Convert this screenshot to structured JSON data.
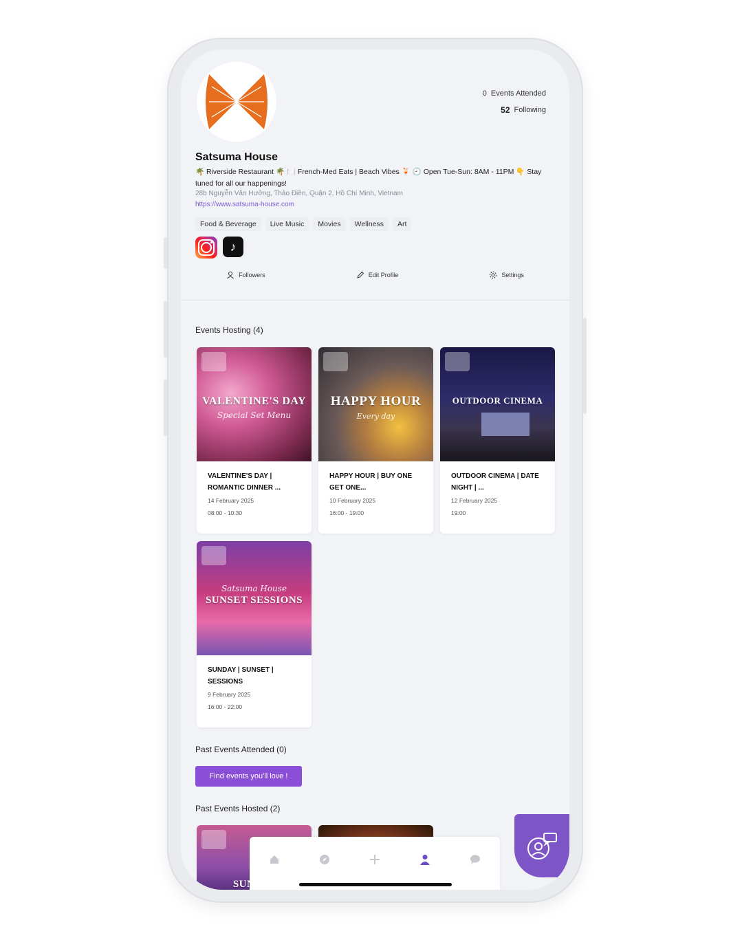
{
  "profile": {
    "name": "Satsuma House",
    "bio": "🌴 Riverside Restaurant 🌴 🍽️ French-Med Eats | Beach Vibes 🍹 🕘 Open Tue-Sun: 8AM - 11PM 👇 Stay tuned for all our happenings!",
    "address": "28b Nguyễn Văn Hưởng, Thảo Điền, Quận 2, Hồ Chí Minh, Vietnam",
    "website": "https://www.satsuma-house.com",
    "logo_color": "#E56F1E"
  },
  "stats": {
    "events_attended_count": "0",
    "events_attended_label": "Events Attended",
    "following_count": "52",
    "following_label": "Following"
  },
  "tags": [
    "Food & Beverage",
    "Live Music",
    "Movies",
    "Wellness",
    "Art"
  ],
  "social": [
    {
      "icon": "instagram-icon"
    },
    {
      "icon": "tiktok-icon"
    }
  ],
  "actions": {
    "followers": "Followers",
    "edit_profile": "Edit Profile",
    "settings": "Settings"
  },
  "sections": {
    "hosting": "Events Hosting (4)",
    "attended": "Past Events Attended (0)",
    "hosted": "Past Events Hosted (2)"
  },
  "events": [
    {
      "img_title": "VALENTINE'S DAY",
      "img_sub": "Special Set Menu",
      "title": "VALENTINE'S DAY | ROMANTIC DINNER ...",
      "date": "14 February 2025",
      "time": "08:00 - 10:30"
    },
    {
      "img_title": "HAPPY HOUR",
      "img_sub": "Every day",
      "title": "HAPPY HOUR | BUY ONE GET ONE...",
      "date": "10 February 2025",
      "time": "16:00 - 19:00"
    },
    {
      "img_title": "OUTDOOR CINEMA",
      "img_sub": "",
      "title": "OUTDOOR CINEMA | DATE NIGHT | ...",
      "date": "12 February 2025",
      "time": "19:00"
    },
    {
      "img_title": "SUNSET SESSIONS",
      "img_sub": "Satsuma House",
      "title": "SUNDAY | SUNSET | SESSIONS",
      "date": "9 February 2025",
      "time": "16:00 - 22:00"
    }
  ],
  "past_hosted": [
    {
      "img_title": "SUNSET"
    },
    {
      "img_title": ""
    }
  ],
  "cta_label": "Find events you'll love !",
  "bottom_nav": [
    "home-icon",
    "explore-icon",
    "add-icon",
    "profile-icon",
    "chat-icon"
  ],
  "colors": {
    "accent": "#8A4FD6",
    "fab": "#7D55C7",
    "active_nav": "#6C4BC4"
  }
}
